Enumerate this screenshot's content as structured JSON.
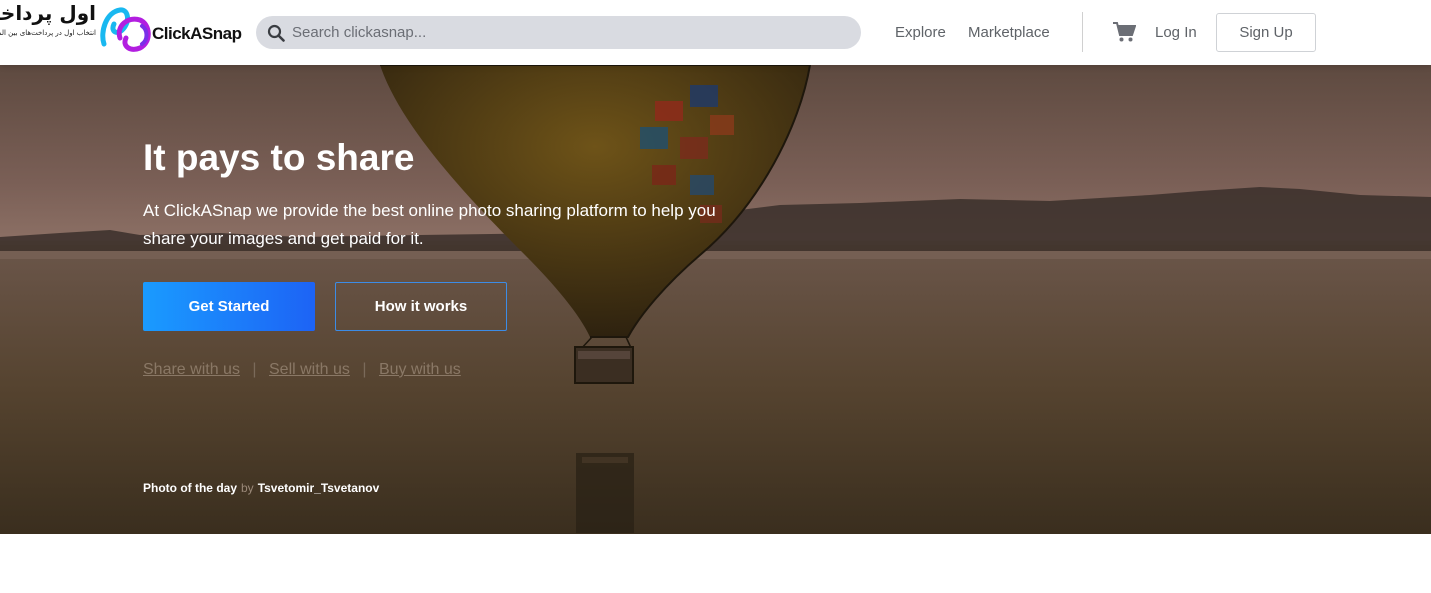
{
  "partner": {
    "title": "اول پرداخت",
    "subtitle": "انتخاب اول در پرداخت‌های بین المللی"
  },
  "brand": {
    "name": "ClickASnap",
    "mark_colors": [
      "#19b8f0",
      "#b21ee0"
    ]
  },
  "search": {
    "placeholder": "Search clickasnap...",
    "value": ""
  },
  "nav": {
    "explore": "Explore",
    "marketplace": "Marketplace",
    "login": "Log In",
    "signup": "Sign Up"
  },
  "hero": {
    "title": "It pays to share",
    "description": "At ClickASnap we provide the best online photo sharing platform to help you share your images and get paid for it.",
    "primary_button": "Get Started",
    "secondary_button": "How it works",
    "links": [
      "Share with us",
      "Sell with us",
      "Buy with us"
    ],
    "photo_label": "Photo of the day",
    "photo_by": "by",
    "photo_author": "Tsvetomir_Tsvetanov"
  },
  "colors": {
    "accent": "#1d6ff5",
    "outline_accent": "#3c8ce6",
    "search_bg": "#d9dbe1"
  },
  "icons": [
    "search-icon",
    "cart-icon"
  ]
}
